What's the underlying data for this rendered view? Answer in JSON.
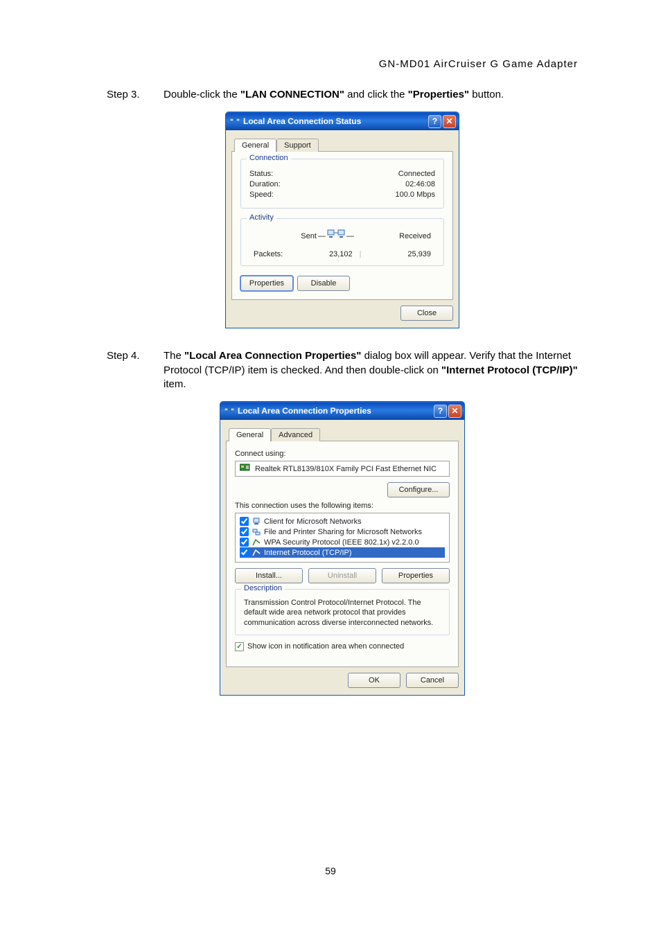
{
  "header": "GN-MD01  AirCruiser  G  Game  Adapter",
  "pagenum": "59",
  "step3": {
    "label": "Step 3.",
    "pre": "Double-click the ",
    "b1": "\"LAN CONNECTION\"",
    "mid": " and click the ",
    "b2": "\"Properties\"",
    "post": " button."
  },
  "step4": {
    "label": "Step 4.",
    "pre": "The ",
    "b1": "\"Local Area Connection Properties\"",
    "mid1": " dialog box will appear. Verify that the Internet Protocol (TCP/IP) item is checked. And then double-click on ",
    "b2": "\"Internet Protocol (TCP/IP)\"",
    "post": " item."
  },
  "dlg1": {
    "title": "Local Area Connection Status",
    "tab_general": "General",
    "tab_support": "Support",
    "grp_conn": "Connection",
    "status_k": "Status:",
    "status_v": "Connected",
    "dur_k": "Duration:",
    "dur_v": "02:46:08",
    "spd_k": "Speed:",
    "spd_v": "100.0 Mbps",
    "grp_act": "Activity",
    "sent": "Sent",
    "recv": "Received",
    "pkts": "Packets:",
    "pkts_sent": "23,102",
    "pkts_recv": "25,939",
    "btn_props": "Properties",
    "btn_disable": "Disable",
    "btn_close": "Close"
  },
  "dlg2": {
    "title": "Local Area Connection Properties",
    "tab_general": "General",
    "tab_advanced": "Advanced",
    "connect_using": "Connect using:",
    "device": "Realtek RTL8139/810X Family PCI Fast Ethernet NIC",
    "btn_configure": "Configure...",
    "items_lbl": "This connection uses the following items:",
    "item1": "Client for Microsoft Networks",
    "item2": "File and Printer Sharing for Microsoft Networks",
    "item3": "WPA Security Protocol (IEEE 802.1x) v2.2.0.0",
    "item4": "Internet Protocol (TCP/IP)",
    "btn_install": "Install...",
    "btn_uninstall": "Uninstall",
    "btn_properties": "Properties",
    "grp_desc": "Description",
    "desc": "Transmission Control Protocol/Internet Protocol. The default wide area network protocol that provides communication across diverse interconnected networks.",
    "notif_chk": "✓",
    "notif": "Show icon in notification area when connected",
    "btn_ok": "OK",
    "btn_cancel": "Cancel"
  }
}
